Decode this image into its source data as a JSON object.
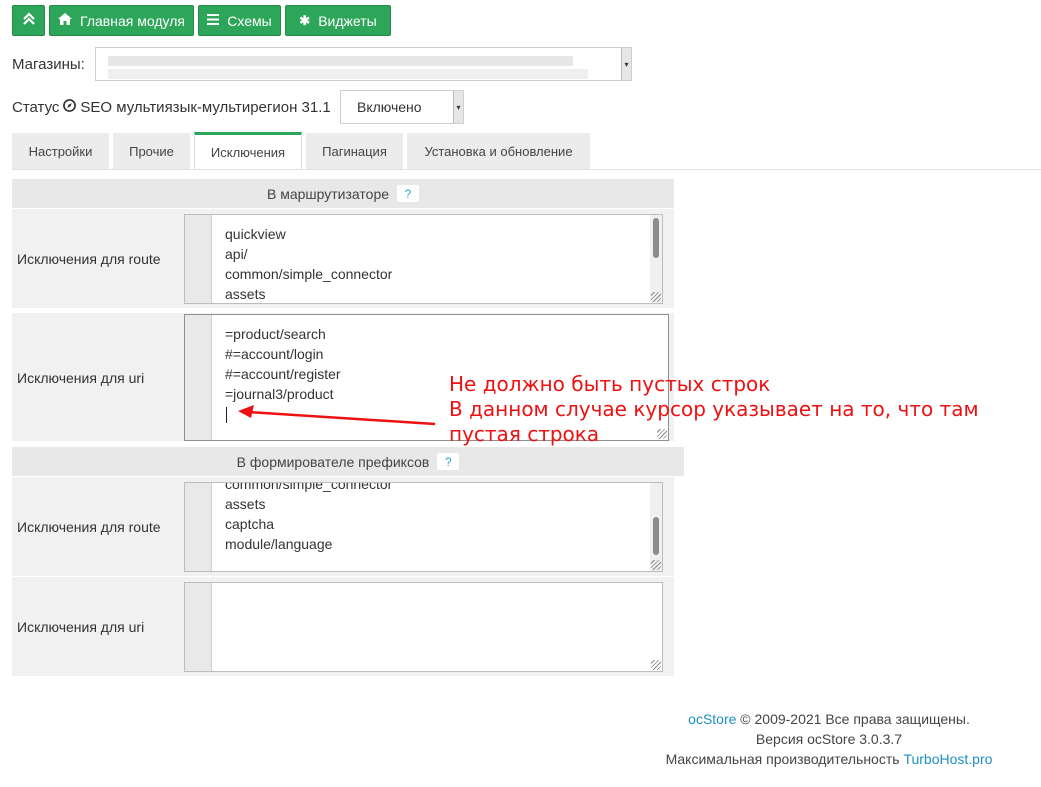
{
  "toolbar": {
    "collapse_icon": "chevrons-up-icon",
    "home_label": "Главная модуля",
    "home_icon": "home-icon",
    "schemes_label": "Схемы",
    "schemes_icon": "list-icon",
    "widgets_label": "Виджеты",
    "widgets_icon": "asterisk-icon",
    "accent_color": "#2ea65a"
  },
  "stores": {
    "label": "Магазины:"
  },
  "status": {
    "label": "Статус",
    "module_name": "SEO мультиязык-мультирегион 31.1",
    "value": "Включено"
  },
  "tabs": [
    {
      "label": "Настройки",
      "active": false
    },
    {
      "label": "Прочие",
      "active": false
    },
    {
      "label": "Исключения",
      "active": true
    },
    {
      "label": "Пагинация",
      "active": false
    },
    {
      "label": "Установка и обновление",
      "active": false
    }
  ],
  "router": {
    "header": "В маршрутизаторе",
    "help": "?",
    "route_label": "Исключения для route",
    "route_lines": [
      "quickview",
      "api/",
      "common/simple_connector",
      "assets"
    ],
    "uri_label": "Исключения для uri",
    "uri_lines": [
      "=product/search",
      "#=account/login",
      "#=account/register",
      "=journal3/product",
      ""
    ]
  },
  "prefix": {
    "header": "В формирователе префиксов",
    "help": "?",
    "route_label": "Исключения для route",
    "route_lines": [
      "common/simple_connector",
      "assets",
      "captcha",
      "module/language"
    ],
    "uri_label": "Исключения для uri",
    "uri_lines": []
  },
  "annotation": {
    "lines": [
      "Не должно быть пустых строк",
      "В данном случае курсор указывает на то, что там",
      "пустая строка"
    ],
    "color": "#ee1111"
  },
  "footer": {
    "brand": "ocStore",
    "copyright": " © 2009-2021 Все права защищены.",
    "version": "Версия ocStore 3.0.3.7",
    "perf_text": "Максимальная производительность ",
    "host_link": "TurboHost.pro",
    "link_color": "#1f8ec3"
  }
}
